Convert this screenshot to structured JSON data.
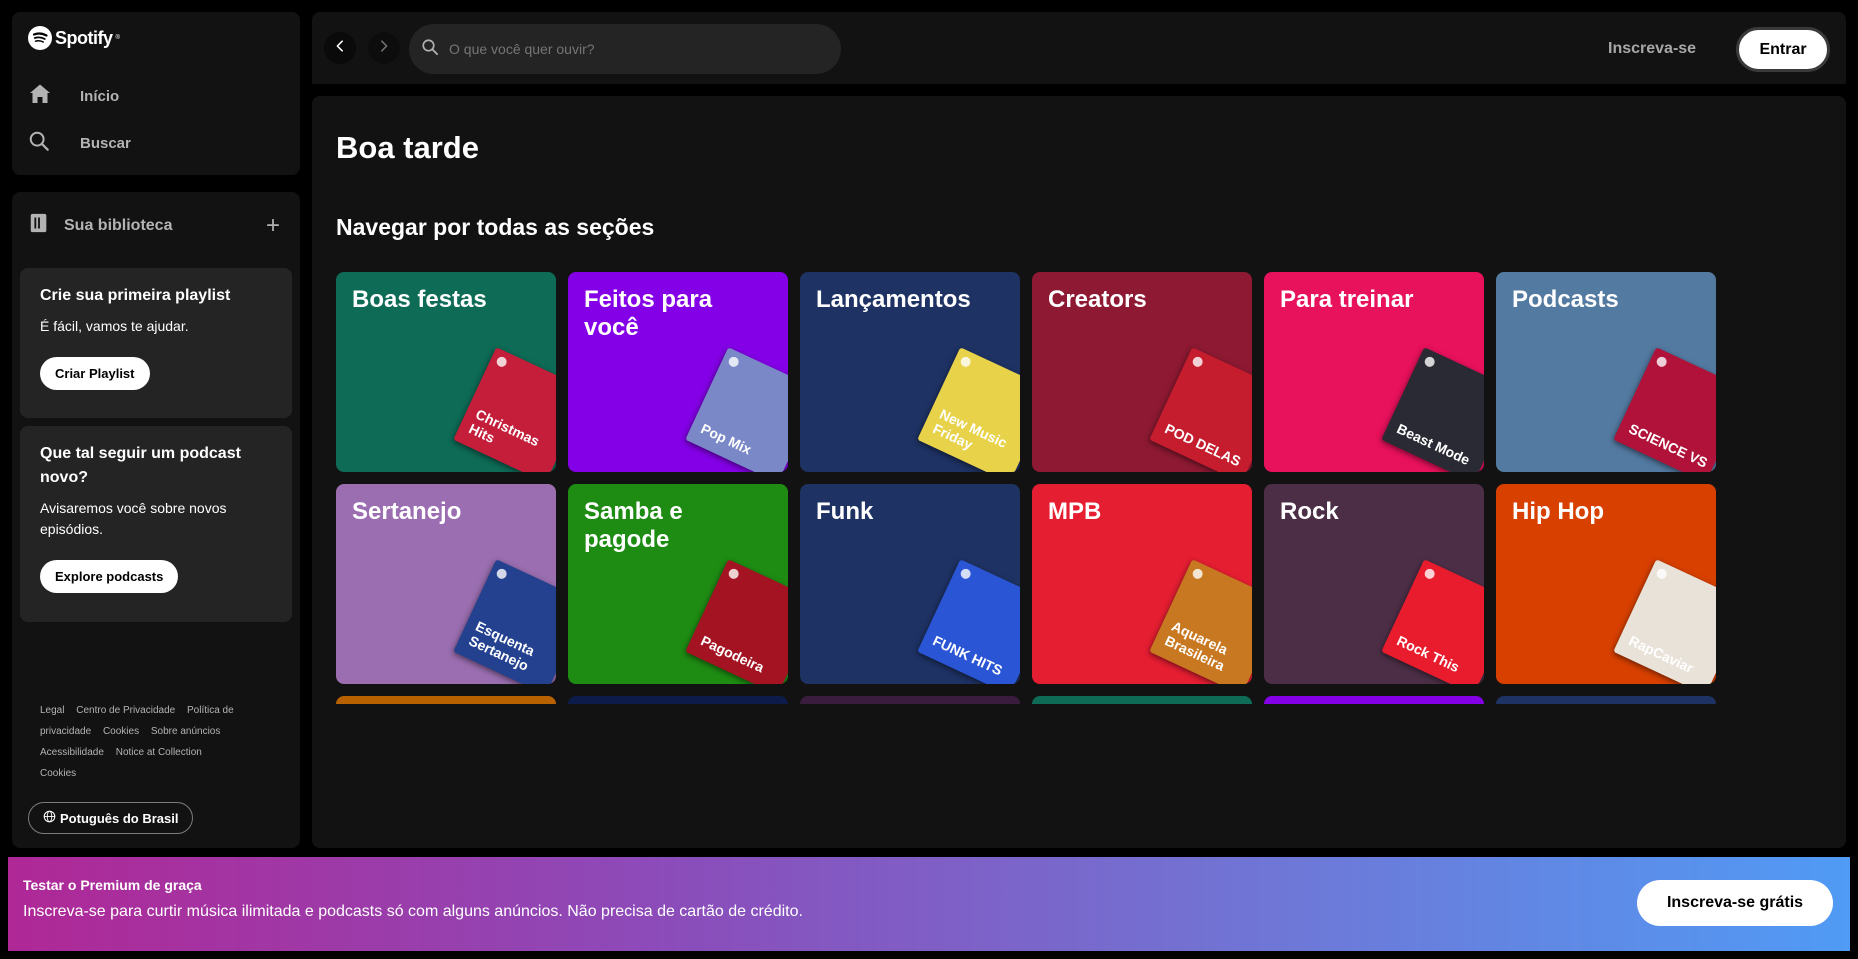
{
  "sidebar": {
    "logo_text": "Spotify",
    "logo_sup": "®",
    "nav": [
      {
        "label": "Início",
        "icon": "home-icon"
      },
      {
        "label": "Buscar",
        "icon": "search-icon"
      }
    ],
    "library": {
      "title": "Sua biblioteca",
      "add_symbol": "+",
      "cards": [
        {
          "title": "Crie sua primeira playlist",
          "text": "É fácil, vamos te ajudar.",
          "button": "Criar Playlist"
        },
        {
          "title": "Que tal seguir um podcast novo?",
          "text": "Avisaremos você sobre novos episódios.",
          "button": "Explore podcasts"
        }
      ],
      "footer_links": [
        "Legal",
        "Centro de Privacidade",
        "Política de privacidade",
        "Cookies",
        "Sobre anúncios",
        "Acessibilidade",
        "Notice at Collection",
        "Cookies"
      ],
      "language_button": "Potuguês do Brasil"
    }
  },
  "topbar": {
    "search_placeholder": "O que você quer ouvir?",
    "signup_label": "Inscreva-se",
    "login_label": "Entrar"
  },
  "main": {
    "greeting": "Boa tarde",
    "section_title": "Navegar por todas as seções",
    "tiles": [
      {
        "label": "Boas festas",
        "color": "#0d6b56",
        "art_color": "#c41e3a",
        "art_text": "Christmas Hits"
      },
      {
        "label": "Feitos para você",
        "color": "#8400e7",
        "art_color": "#7a88c8",
        "art_text": "Pop Mix"
      },
      {
        "label": "Lançamentos",
        "color": "#1e3264",
        "art_color": "#e8d24a",
        "art_text": "New Music Friday"
      },
      {
        "label": "Creators",
        "color": "#8d1932",
        "art_color": "#c51d2e",
        "art_text": "POD DELAS"
      },
      {
        "label": "Para treinar",
        "color": "#e8115b",
        "art_color": "#2a2a35",
        "art_text": "Beast Mode"
      },
      {
        "label": "Podcasts",
        "color": "#537aa1",
        "art_color": "#b0123a",
        "art_text": "SCIENCE VS"
      },
      {
        "label": "Sertanejo",
        "color": "#9a6eb0",
        "art_color": "#23418f",
        "art_text": "Esquenta Sertanejo"
      },
      {
        "label": "Samba e pagode",
        "color": "#1e8c13",
        "art_color": "#a31322",
        "art_text": "Pagodeira"
      },
      {
        "label": "Funk",
        "color": "#1e3264",
        "art_color": "#2a55d4",
        "art_text": "FUNK HITS"
      },
      {
        "label": "MPB",
        "color": "#e61e32",
        "art_color": "#c87820",
        "art_text": "Aquarela Brasileira"
      },
      {
        "label": "Rock",
        "color": "#4c2f47",
        "art_color": "#e81c2d",
        "art_text": "Rock This"
      },
      {
        "label": "Hip Hop",
        "color": "#d84000",
        "art_color": "#e9e2d8",
        "art_text": "RapCaviar"
      }
    ],
    "stubs": [
      "#b86101",
      "#0d1b4a",
      "#3a1d3e",
      "#0d6b56",
      "#8400e7",
      "#1e3264"
    ]
  },
  "banner": {
    "title": "Testar o Premium de graça",
    "text": "Inscreva-se para curtir música ilimitada e podcasts só com alguns anúncios. Não precisa de cartão de crédito.",
    "cta": "Inscreva-se grátis"
  }
}
